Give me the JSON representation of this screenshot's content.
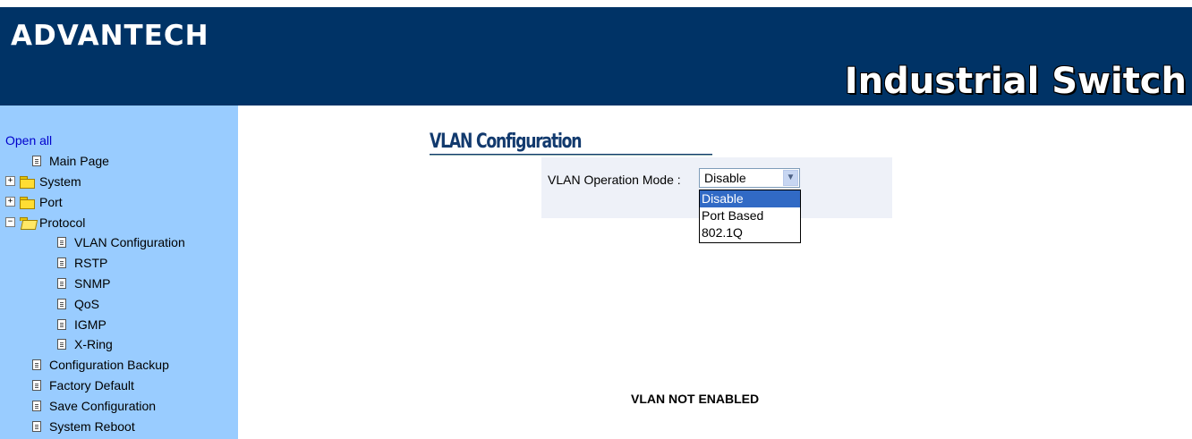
{
  "header": {
    "brand": "ADVANTECH",
    "product": "Industrial Switch",
    "bg_color": "#003366"
  },
  "sidebar": {
    "bg_color": "#99ccff",
    "open_all": "Open all",
    "items": [
      {
        "label": "Main Page",
        "icon": "doc-icon"
      },
      {
        "label": "System",
        "icon": "folder-icon",
        "expand": "+"
      },
      {
        "label": "Port",
        "icon": "folder-icon",
        "expand": "+"
      },
      {
        "label": "Protocol",
        "icon": "open-folder-icon",
        "expand": "−"
      },
      {
        "label": "VLAN Configuration",
        "icon": "doc-icon"
      },
      {
        "label": "RSTP",
        "icon": "doc-icon"
      },
      {
        "label": "SNMP",
        "icon": "doc-icon"
      },
      {
        "label": "QoS",
        "icon": "doc-icon"
      },
      {
        "label": "IGMP",
        "icon": "doc-icon"
      },
      {
        "label": "X-Ring",
        "icon": "doc-icon"
      },
      {
        "label": "Configuration Backup",
        "icon": "doc-icon"
      },
      {
        "label": "Factory Default",
        "icon": "doc-icon"
      },
      {
        "label": "Save Configuration",
        "icon": "doc-icon"
      },
      {
        "label": "System Reboot",
        "icon": "doc-icon"
      }
    ]
  },
  "main": {
    "title": "VLAN Configuration",
    "mode_label": "VLAN Operation Mode :",
    "mode_value": "Disable",
    "options": [
      "Disable",
      "Port Based",
      "802.1Q"
    ],
    "selected_option": "Disable",
    "status": "VLAN NOT ENABLED"
  }
}
